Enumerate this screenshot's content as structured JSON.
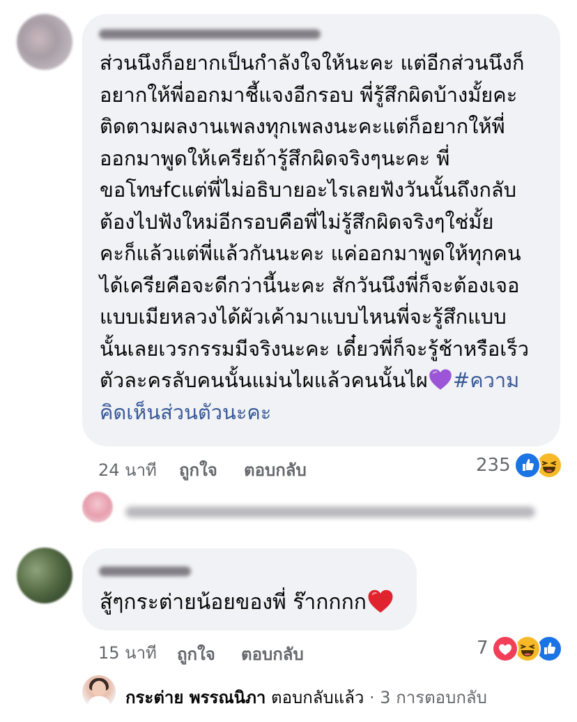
{
  "comment1": {
    "lines": [
      "ส่วนนึงก็อยากเป็นกำลังใจให้นะคะ แต่อีกส่วนนึงก็",
      "อยากให้พี่ออกมาชี้แจงอีกรอบ พี่รู้สึกผิดบ้างมั้ยคะ",
      "ติดตามผลงานเพลงทุกเพลงนะคะแต่ก็อยากให้พี่",
      "ออกมาพูดให้เครียถ้ารู้สึกผิดจริงๆนะคะ พี่",
      "ขอโทษfcแต่พี่ไม่อธิบายอะไรเลยฟังวันนั้นถึงกลับ",
      "ต้องไปฟังใหม่อีกรอบคือพี่ไม่รู้สึกผิดจริงๆใช่มั้ย",
      "คะก็แล้วแต่พี่แล้วกันนะคะ แค่ออกมาพูดให้ทุกคน",
      "ได้เครียคือจะดีกว่านี้นะคะ สักวันนึงพี่ก็จะต้องเจอ",
      "แบบเมียหลวงได้ผัวเค้ามาแบบไหนพี่จะรู้สึกแบบ",
      "นั้นเลยเวรกรรมมีจริงนะคะ เดี๋ยวพี่ก็จะรู้ช้าหรือเร็ว"
    ],
    "line11": "ตัวละครลับคนนั้นแม่นไผแล้วคนนั้นไผ",
    "hashtag_part1": "#ความ",
    "hashtag_part2": "คิดเห็นส่วนตัวนะคะ",
    "time": "24 นาที",
    "like_label": "ถูกใจ",
    "reply_label": "ตอบกลับ",
    "reaction_count": "235",
    "reactions": [
      "like-icon",
      "haha-icon"
    ]
  },
  "comment2": {
    "text": "สู้ๆกระต่ายน้อยของพี่ ร๊ากกกก",
    "time": "15 นาที",
    "like_label": "ถูกใจ",
    "reply_label": "ตอบกลับ",
    "reaction_count": "7",
    "reactions": [
      "love-icon",
      "haha-icon",
      "like-icon"
    ]
  },
  "reply_summary": {
    "name": "กระต่าย พรรณนิภา",
    "action": "ตอบกลับแล้ว",
    "separator": "·",
    "count": "3 การตอบกลับ"
  },
  "colors": {
    "bubble": "#f0f2f5",
    "meta_text": "#65676b",
    "hashtag": "#385898",
    "like": "#1b74e4",
    "haha": "#f7b928",
    "love": "#f33e58"
  }
}
